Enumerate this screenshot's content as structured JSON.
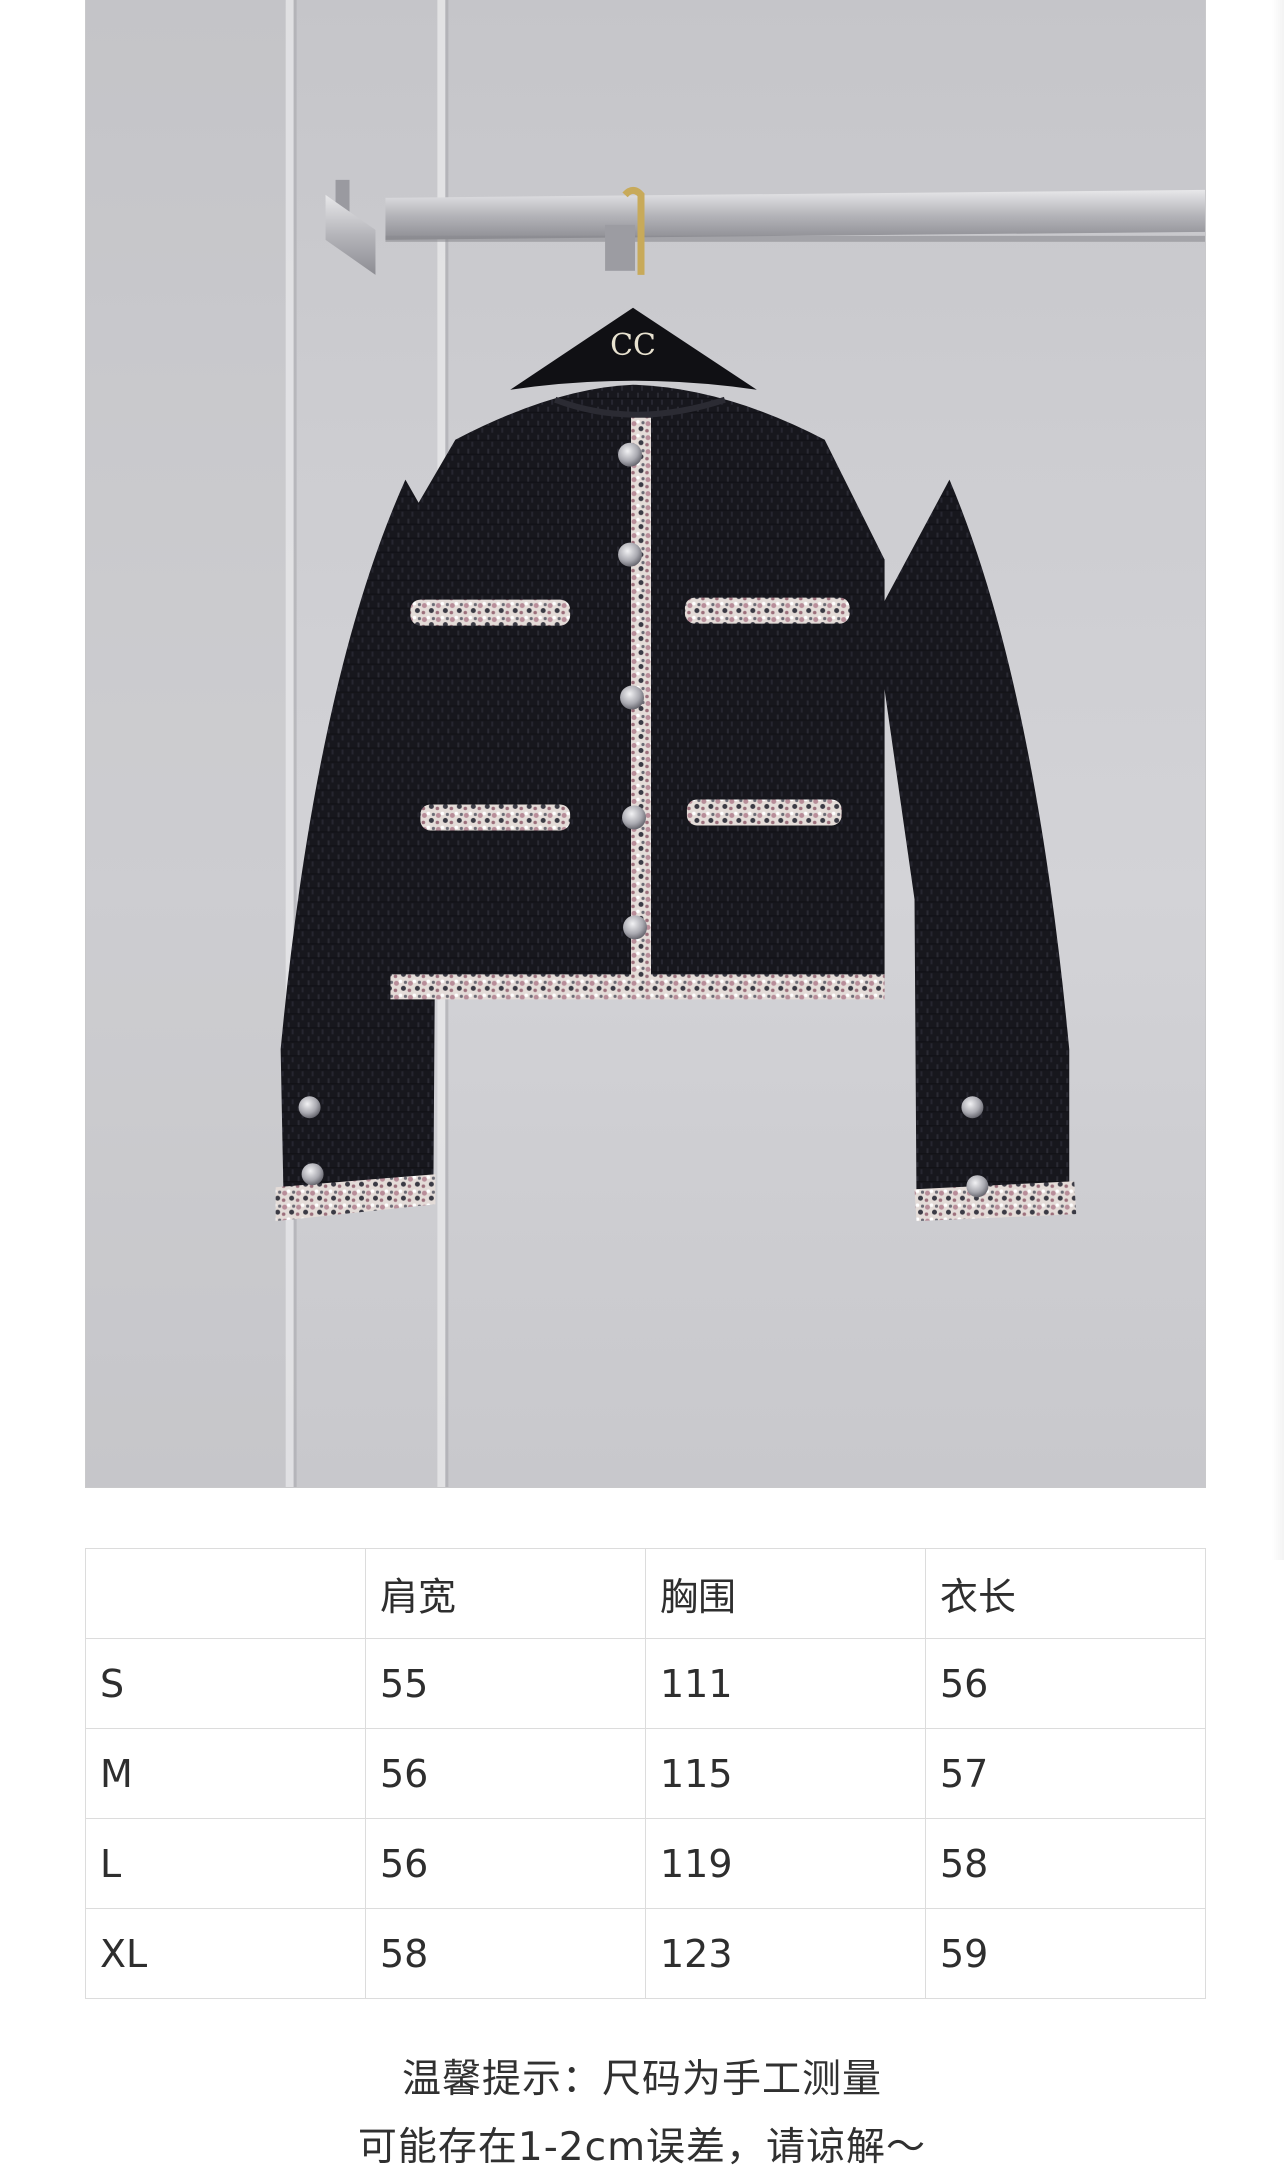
{
  "product_image": {
    "hanger_logo": "CC",
    "colors": {
      "wall": "#cfcfd3",
      "jacket": "#16161c",
      "trim": "#d9ccc8",
      "rail": "#b9b9bd"
    }
  },
  "size_table": {
    "headers": [
      "",
      "肩宽",
      "胸围",
      "衣长"
    ],
    "rows": [
      [
        "S",
        "55",
        "111",
        "56"
      ],
      [
        "M",
        "56",
        "115",
        "57"
      ],
      [
        "L",
        "56",
        "119",
        "58"
      ],
      [
        "XL",
        "58",
        "123",
        "59"
      ]
    ]
  },
  "notice": {
    "line1": "温馨提示：尺码为手工测量",
    "line2": "可能存在1-2cm误差，请谅解～"
  }
}
